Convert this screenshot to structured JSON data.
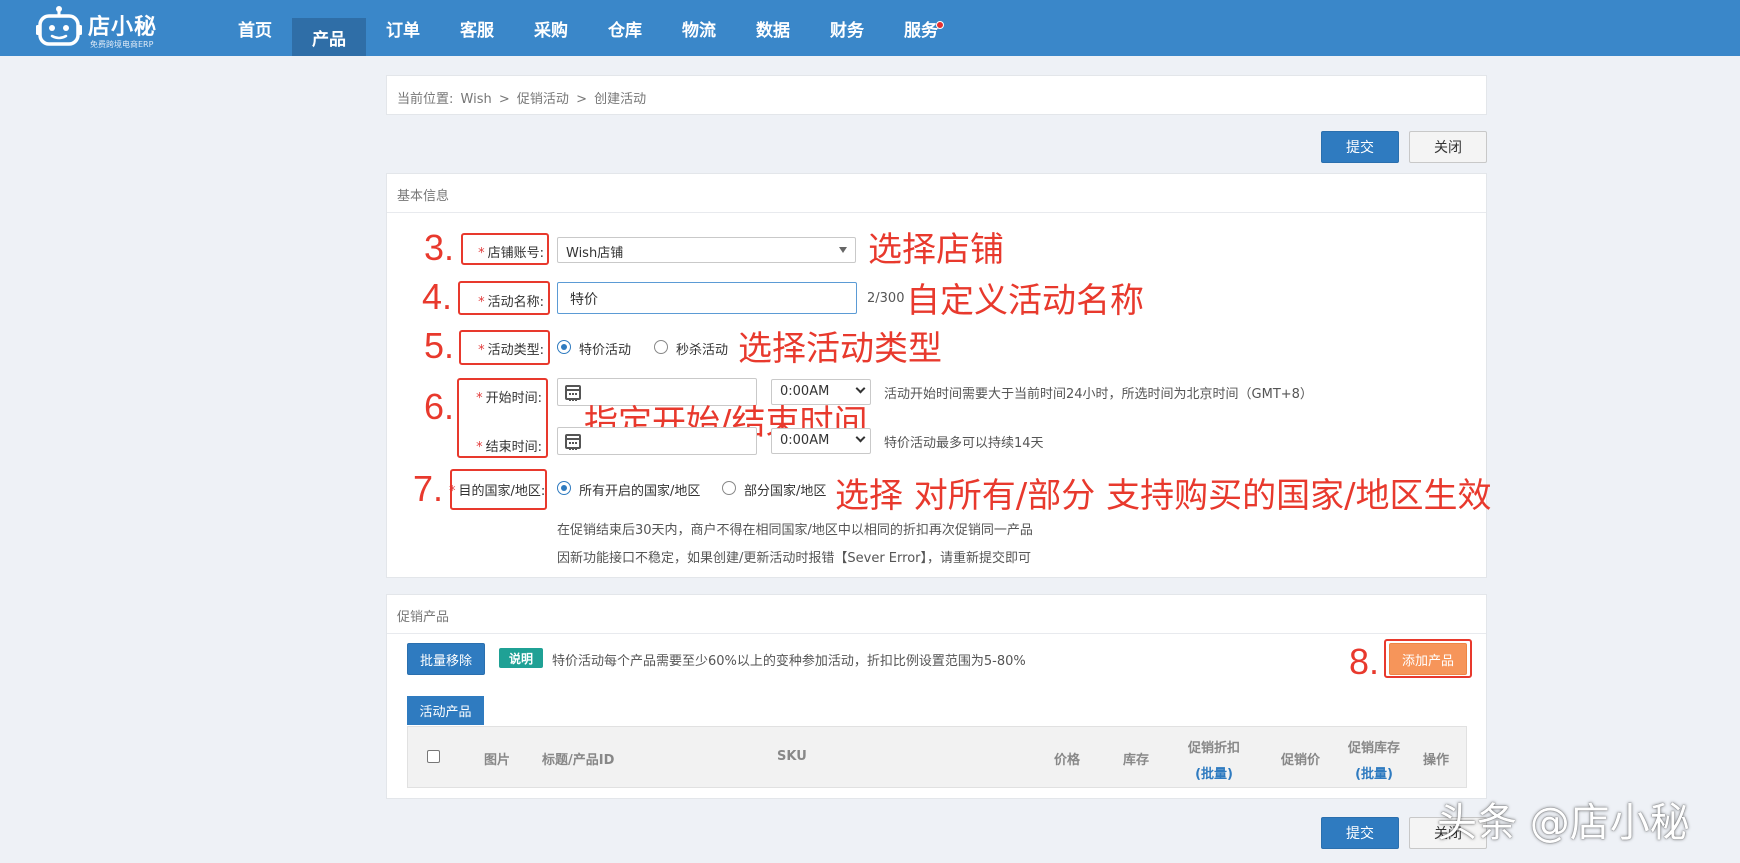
{
  "app": {
    "brand": "店小秘",
    "subtitle": "免费跨境电商ERP"
  },
  "nav": {
    "items": [
      {
        "label": "首页"
      },
      {
        "label": "产品"
      },
      {
        "label": "订单"
      },
      {
        "label": "客服"
      },
      {
        "label": "采购"
      },
      {
        "label": "仓库"
      },
      {
        "label": "物流"
      },
      {
        "label": "数据"
      },
      {
        "label": "财务"
      },
      {
        "label": "服务"
      }
    ],
    "active": "产品",
    "notification_color": "#e53030"
  },
  "breadcrumb": {
    "prefix": "当前位置:",
    "items": [
      "Wish",
      "促销活动",
      "创建活动"
    ],
    "separator": ">"
  },
  "actions": {
    "submit_label": "提交",
    "close_label": "关闭"
  },
  "basic_info": {
    "title": "基本信息",
    "store": {
      "label": "店铺账号:",
      "value": "Wish店铺"
    },
    "activity_name": {
      "label": "活动名称:",
      "value": "特价",
      "counter": "2/300"
    },
    "activity_type": {
      "label": "活动类型:",
      "options": [
        "特价活动",
        "秒杀活动"
      ],
      "selected": "特价活动"
    },
    "start_time": {
      "label": "开始时间:",
      "time": "0:00AM",
      "hint": "活动开始时间需要大于当前时间24小时，所选时间为北京时间（GMT+8）"
    },
    "end_time": {
      "label": "结束时间:",
      "time": "0:00AM",
      "hint": "特价活动最多可以持续14天"
    },
    "region": {
      "label": "目的国家/地区:",
      "options": [
        "所有开启的国家/地区",
        "部分国家/地区"
      ],
      "selected": "所有开启的国家/地区"
    },
    "notes": [
      "在促销结束后30天内，商户不得在相同国家/地区中以相同的折扣再次促销同一产品",
      "因新功能接口不稳定，如果创建/更新活动时报错【Sever Error】，请重新提交即可"
    ]
  },
  "annotations": {
    "steps": [
      "3.",
      "4.",
      "5.",
      "6.",
      "7.",
      "8."
    ],
    "texts": [
      "选择店铺",
      "自定义活动名称",
      "选择活动类型",
      "指定开始/结束时间",
      "选择 对所有/部分 支持购买的国家/地区生效"
    ],
    "color": "#e8392d"
  },
  "promo_products": {
    "title": "促销产品",
    "bulk_remove_label": "批量移除",
    "tag_label": "说明",
    "tag_text": "特价活动每个产品需要至少60%以上的变种参加活动，折扣比例设置范围为5-80%",
    "add_product_label": "添加产品",
    "tab_label": "活动产品",
    "columns": {
      "image": "图片",
      "title": "标题/产品ID",
      "sku": "SKU",
      "price": "价格",
      "stock": "库存",
      "discount": "促销折扣",
      "discount_bulk": "(批量)",
      "promo_price": "促销价",
      "promo_stock": "促销库存",
      "promo_stock_bulk": "(批量)",
      "action": "操作"
    }
  },
  "watermark": "头条 @店小秘"
}
